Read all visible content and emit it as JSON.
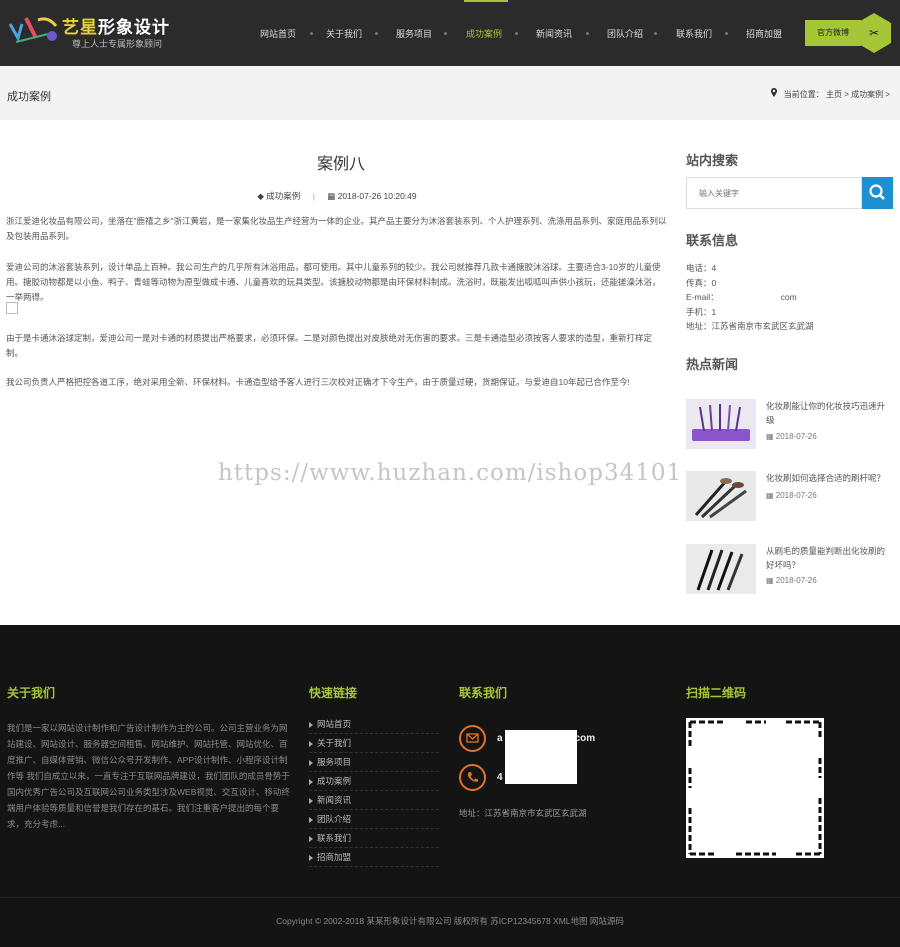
{
  "header": {
    "logo_title": "艺星",
    "logo_title_rest": "形象设计",
    "logo_sub": "尊上人士专属形象顾问",
    "nav": [
      {
        "label": "网站首页"
      },
      {
        "label": "关于我们"
      },
      {
        "label": "服务项目"
      },
      {
        "label": "成功案例",
        "active": true
      },
      {
        "label": "新闻资讯"
      },
      {
        "label": "团队介绍"
      },
      {
        "label": "联系我们"
      },
      {
        "label": "招商加盟"
      }
    ],
    "weibo_label": "官方微博",
    "accent_color": "#a4c637"
  },
  "titlebar": {
    "title": "成功案例",
    "crumb_prefix": "当前位置：",
    "crumb_home": "主页",
    "crumb_sep": ">",
    "crumb_current": "成功案例",
    "crumb_tail": ">"
  },
  "article": {
    "title": "案例八",
    "category": "成功案例",
    "date": "2018-07-26 10:20:49",
    "paragraphs": [
      "浙江爱迪化妆品有限公司，坐落在\"鹿禧之乡\"浙江黄岩，是一家集化妆品生产经营为一体的企业。其产品主要分为沐浴套装系列、个人护理系列、洗涤用品系列、家庭用品系列以及包装用品系列。",
      "爱迪公司的沐浴套装系列，设计单品上百种。我公司生产的几乎所有沐浴用品，都可使用。其中儿童系列的较少。我公司就推荐几款卡通搪胶沐浴球。主要适合3-10岁的儿童使用。搪胶动物都是以小鱼、鸭子、青蛙等动物为原型做成卡通、儿童喜欢的玩具类型。该搪胶动物都是由环保材料制成。洗浴时，既能发出呱呱叫声供小孩玩，还能搓澡沐浴，一举两得。",
      "由于是卡通沐浴球定制，爱迪公司一是对卡通的材质提出严格要求，必须环保。二是对颜色提出对皮肤绝对无伤害的要求。三是卡通造型必须按客人要求的造型，重新打样定制。",
      "我公司负责人严格把控各道工序，绝对采用全新、环保材料。卡通造型给予客人进行三次校对正确才下令生产，由于质量过硬，货期保证。与爱迪自10年起已合作至今!"
    ]
  },
  "watermark": "https://www.huzhan.com/ishop34101",
  "sidebar": {
    "search_title": "站内搜索",
    "search_placeholder": "输入关键字",
    "contact_title": "联系信息",
    "contact": [
      {
        "label": "电话：4"
      },
      {
        "label": "传真：0"
      },
      {
        "label": "E-mail：",
        "value": "com"
      },
      {
        "label": "手机：1"
      },
      {
        "label": "地址：江苏省南京市玄武区玄武湖"
      }
    ],
    "news_title": "热点新闻",
    "news": [
      {
        "title": "化妆刷能让你的化妆技巧迅速升级",
        "date": "2018-07-26"
      },
      {
        "title": "化妆刷如何选择合适的刷杆呢？",
        "date": "2018-07-26"
      },
      {
        "title": "从刷毛的质量能判断出化妆刷的好坏吗？",
        "date": "2018-07-26"
      }
    ]
  },
  "footer": {
    "about_title": "关于我们",
    "about_text": "我们是一家以网站设计制作和广告设计制作为主的公司。公司主营业务为网站建设、网站设计、服务器空间租售、网站维护、网站托管、网站优化、百度推广、自媒体营销、微信公众号开发制作、APP设计制作、小程序设计制作等 我们自成立以来，一直专注于互联网品牌建设，我们团队的成员骨势于国内优秀广告公司及互联网公司业务类型涉及WEB视觉、交互设计、移动终端用户体验等质量和信誉是我们存在的基石。我们注重客户提出的每个要求，充分考虑...",
    "links_title": "快速链接",
    "links": [
      "网站首页",
      "关于我们",
      "服务项目",
      "成功案例",
      "新闻资讯",
      "团队介绍",
      "联系我们",
      "招商加盟"
    ],
    "contact_title": "联系我们",
    "email_partial": "a",
    "email_tail": "com",
    "phone_partial": "4",
    "address": "地址：江苏省南京市玄武区玄武湖",
    "qr_title": "扫描二维码",
    "copyright": "Copyright © 2002-2018 某某形象设计有限公司 版权所有  苏ICP12345678  XML地图  网站源码"
  }
}
